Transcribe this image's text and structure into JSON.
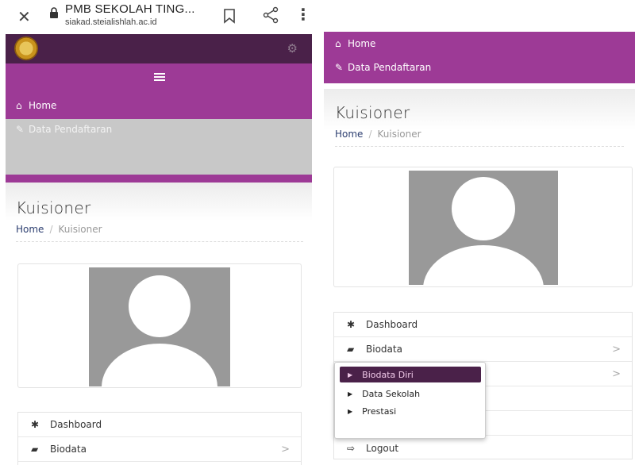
{
  "browser": {
    "close_icon": "close-icon",
    "title": "PMB SEKOLAH TING...",
    "url": "siakad.steialishlah.ac.id"
  },
  "nav": {
    "home": "Home",
    "data_pendaftaran": "Data Pendaftaran"
  },
  "page": {
    "title": "Kuisioner",
    "breadcrumb_home": "Home",
    "breadcrumb_sep": "/",
    "breadcrumb_current": "Kuisioner"
  },
  "menu": {
    "dashboard": "Dashboard",
    "biodata": "Biodata",
    "logout": "Logout",
    "chevron": ">"
  },
  "dropdown": {
    "items": [
      "Biodata Diri",
      "Data Sekolah",
      "Prestasi"
    ]
  },
  "colors": {
    "dark_purple": "#4a2149",
    "purple": "#9d3a96",
    "gray": "#c8c8c8"
  }
}
